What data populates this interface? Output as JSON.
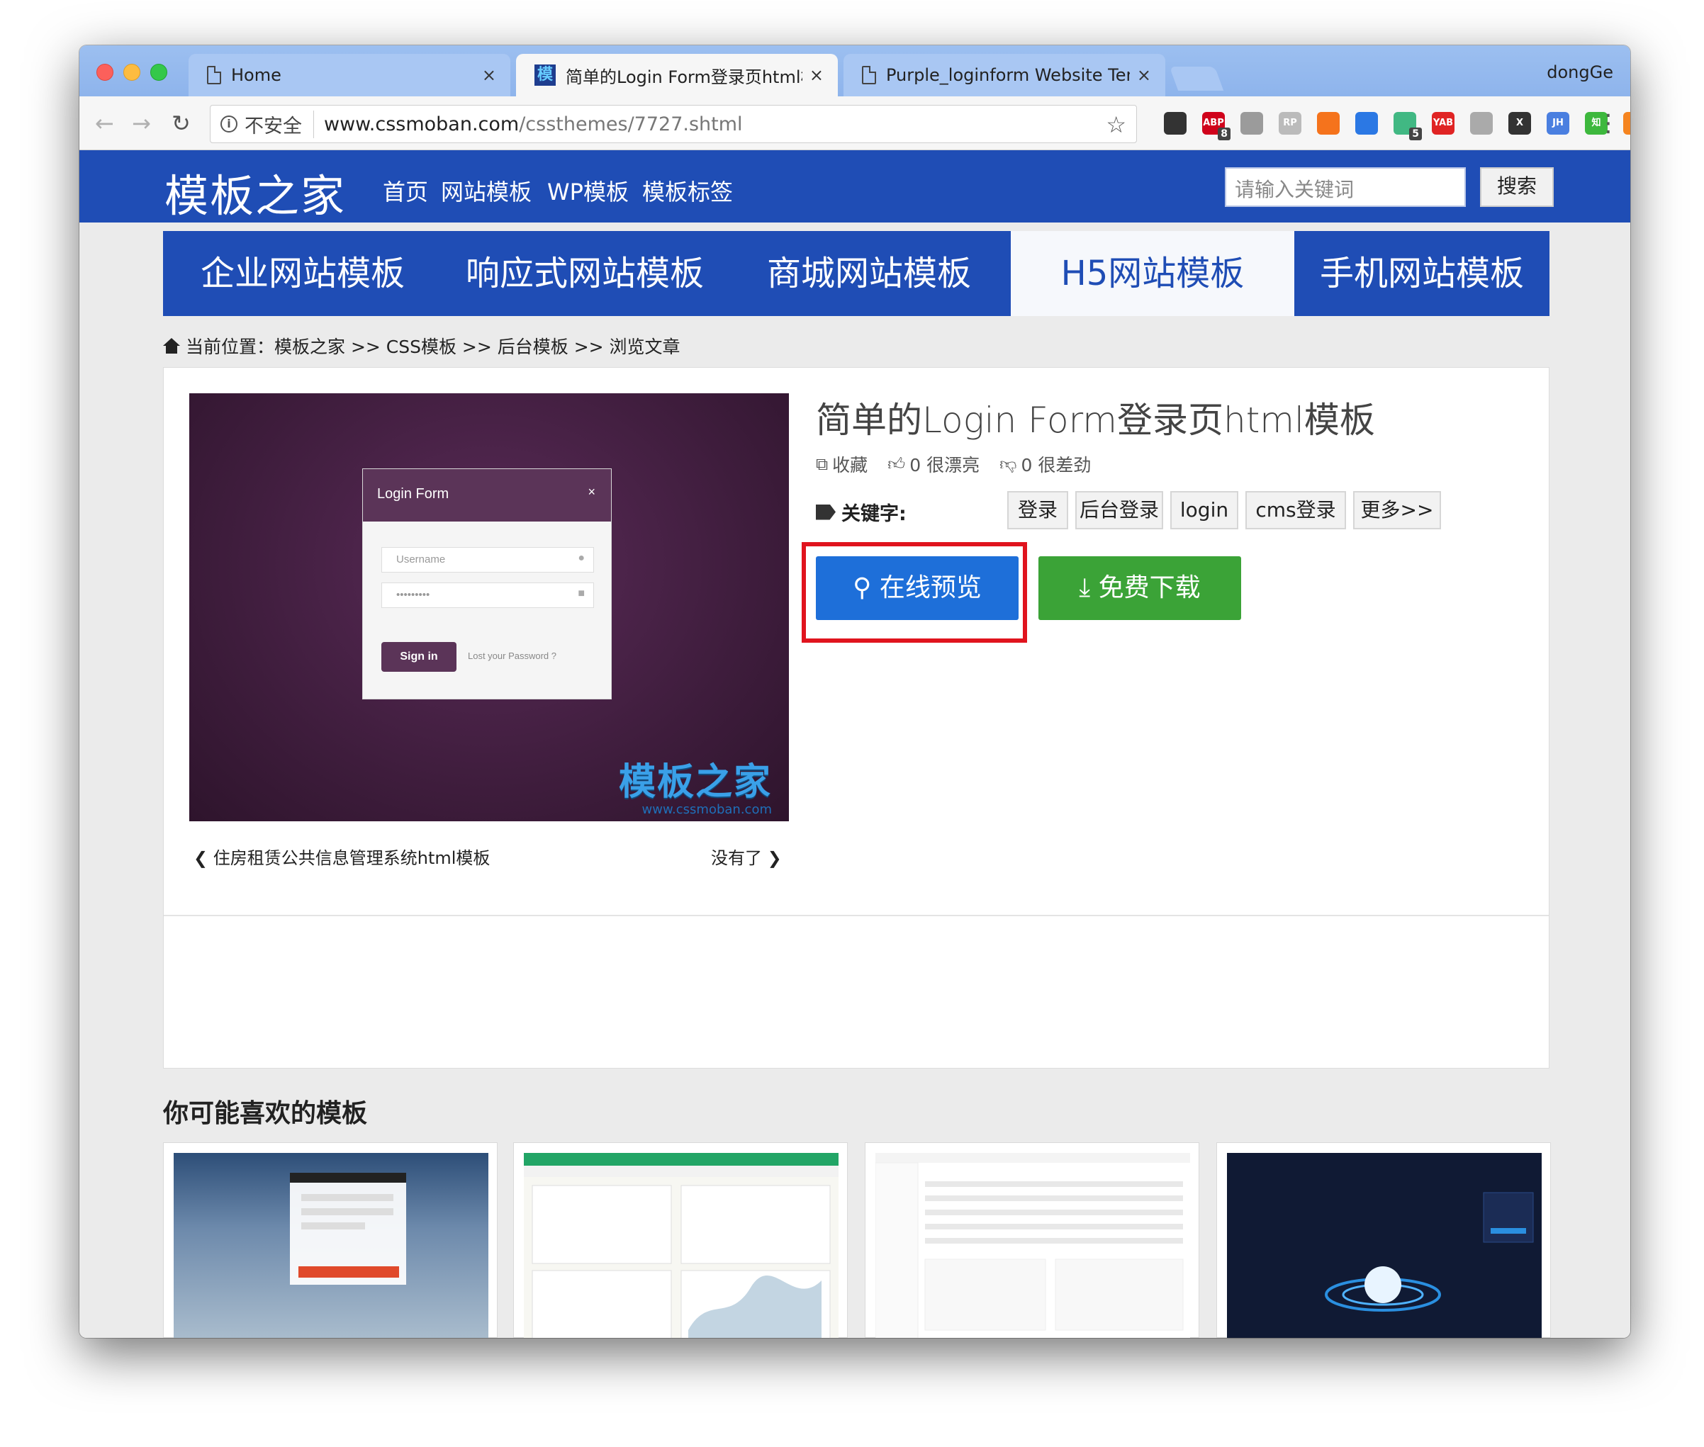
{
  "browser": {
    "tabs": [
      {
        "title": "Home",
        "close": "×",
        "active": false
      },
      {
        "title": "简单的Login Form登录页html模",
        "close": "×",
        "active": true,
        "favicon": "模"
      },
      {
        "title": "Purple_loginform Website Tem",
        "close": "×",
        "active": false
      }
    ],
    "profile_name": "dongGe",
    "security_label": "不安全",
    "url_host": "www.cssmoban.com",
    "url_path": "/cssthemes/7727.shtml",
    "extensions": [
      {
        "name": "qr-code-extension",
        "label": "",
        "color": "#333333"
      },
      {
        "name": "adblock-plus-extension",
        "label": "ABP",
        "color": "#d0021b",
        "badge": "8"
      },
      {
        "name": "globe-extension",
        "label": "",
        "color": "#9b9b9b"
      },
      {
        "name": "rp-extension",
        "label": "RP",
        "color": "#bbbbbb"
      },
      {
        "name": "lifebuoy-extension",
        "label": "",
        "color": "#f5731c"
      },
      {
        "name": "translate-extension",
        "label": "",
        "color": "#2b78e4"
      },
      {
        "name": "vue-devtools-extension",
        "label": "",
        "color": "#41b883",
        "badge": "5"
      },
      {
        "name": "yab-extension",
        "label": "YAB",
        "color": "#e02424"
      },
      {
        "name": "world-extension",
        "label": "",
        "color": "#aaaaaa"
      },
      {
        "name": "x-extension",
        "label": "X",
        "color": "#333333"
      },
      {
        "name": "jh-extension",
        "label": "JH",
        "color": "#4a7fe0"
      },
      {
        "name": "zhihu-extension",
        "label": "知",
        "color": "#3db83d"
      },
      {
        "name": "metamask-extension",
        "label": "",
        "color": "#f5841f"
      }
    ]
  },
  "site": {
    "logo": "模板之家",
    "topnav": [
      "首页",
      "网站模板",
      "WP模板",
      "模板标签"
    ],
    "search_placeholder": "请输入关键词",
    "search_button": "搜索",
    "categories": [
      "企业网站模板",
      "响应式网站模板",
      "商城网站模板",
      "H5网站模板",
      "手机网站模板"
    ],
    "active_category": "H5网站模板",
    "breadcrumb": "当前位置：模板之家 >> CSS模板 >> 后台模板 >> 浏览文章"
  },
  "item": {
    "title": "简单的Login Form登录页html模板",
    "favorite_label": "收藏",
    "likes_label": "0 很漂亮",
    "dislikes_label": "0 很差劲",
    "keywords_label": "关键字:",
    "keywords": [
      "登录",
      "后台登录",
      "login",
      "cms登录",
      "更多>>"
    ],
    "preview_button": "在线预览",
    "download_button": "免费下载",
    "prev_link": "住房租赁公共信息管理系统html模板",
    "next_link": "没有了"
  },
  "preview_image": {
    "form_title": "Login Form",
    "close_glyph": "×",
    "username_placeholder": "Username",
    "password_value": "•••••••••",
    "signin_label": "Sign in",
    "lost_password": "Lost your Password ?",
    "watermark": "模板之家",
    "watermark_url": "www.cssmoban.com"
  },
  "recommend": {
    "title": "你可能喜欢的模板"
  }
}
